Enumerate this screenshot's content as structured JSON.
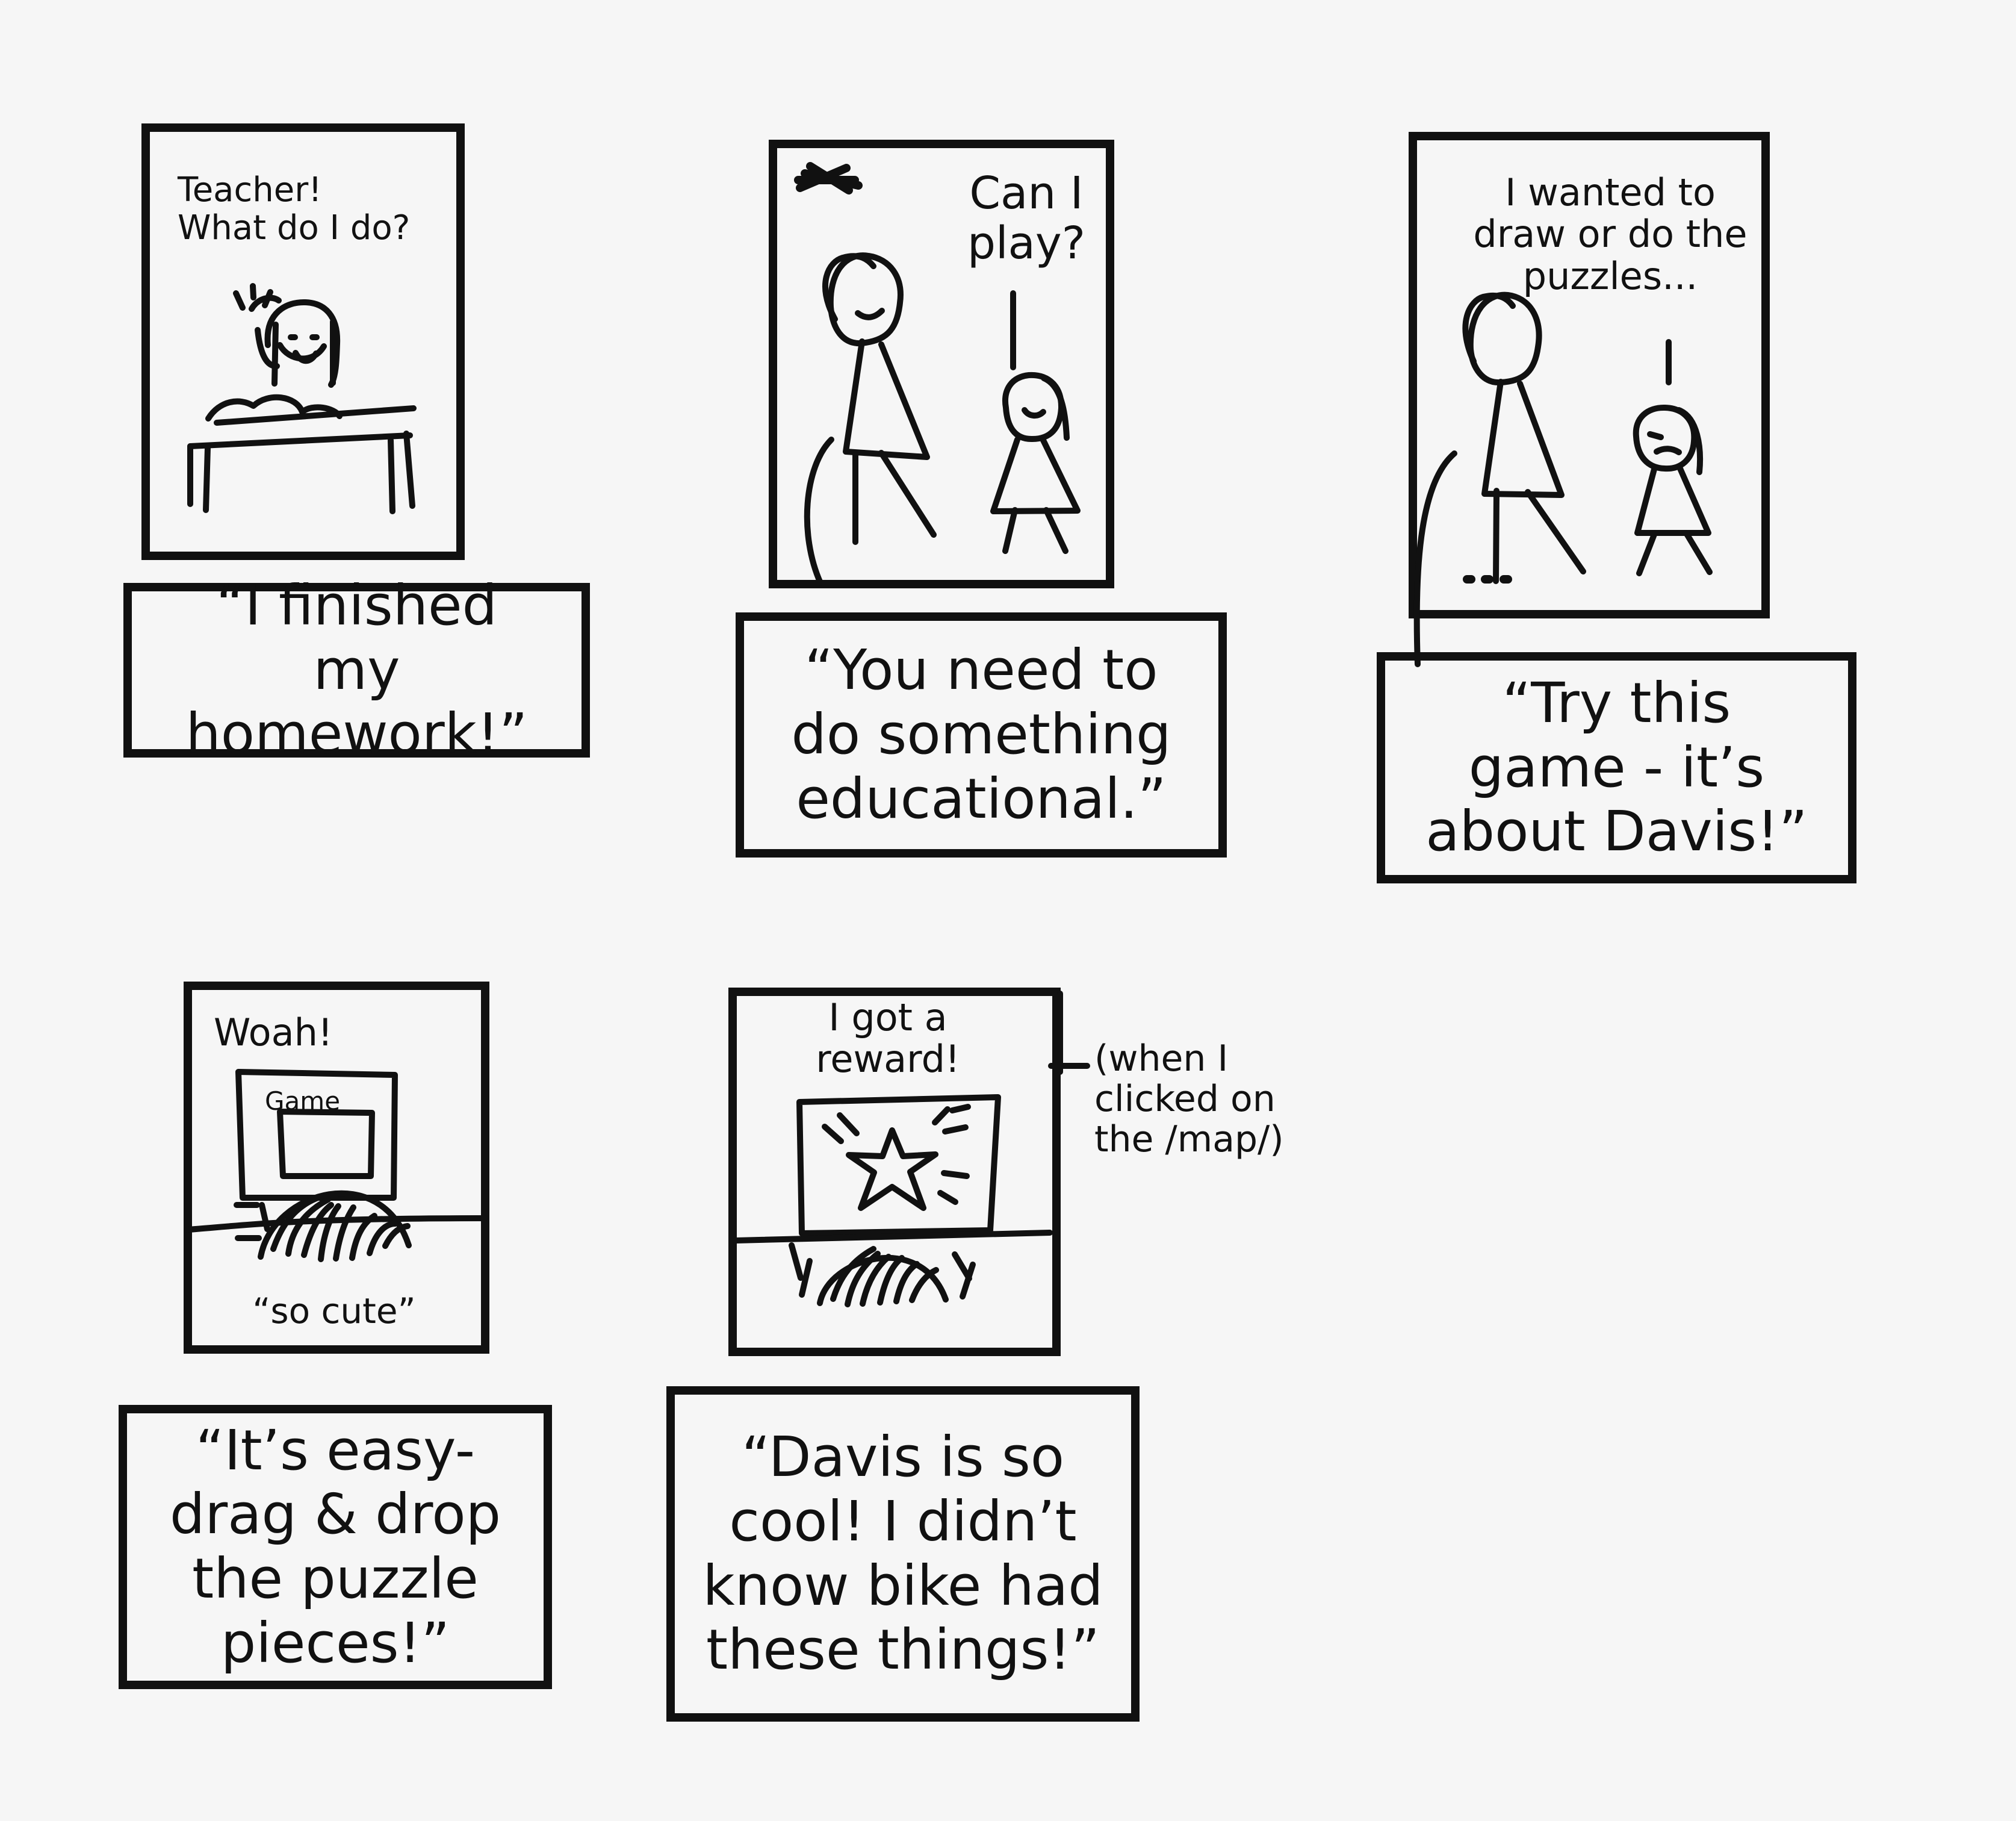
{
  "panels": [
    {
      "name": "panel-1",
      "frame_text": "Teacher!\nWhat do I do?",
      "caption": "“I finished\nmy homework!”"
    },
    {
      "name": "panel-2",
      "frame_text": "Can I\nplay?",
      "caption": "“You need to\ndo something\neducational.”"
    },
    {
      "name": "panel-3",
      "frame_text": "I wanted to\ndraw or do the\npuzzles...",
      "caption": "“Try this\ngame - it’s\nabout Davis!”"
    },
    {
      "name": "panel-4",
      "frame_text": "Woah!",
      "screen_label": "Game",
      "sub_text": "“so cute”",
      "caption": "“It’s easy-\ndrag & drop\nthe puzzle\npieces!”"
    },
    {
      "name": "panel-5",
      "frame_text": "I got a\nreward!",
      "side_note": "(when I\nclicked on\nthe /map/)",
      "caption": "“Davis is so\ncool! I didn’t\nknow bike had\nthese things!”"
    }
  ],
  "icons": {
    "child": "child-figure-icon",
    "adult": "adult-figure-icon",
    "desk": "desk-icon",
    "star": "star-icon",
    "screen": "screen-icon"
  }
}
